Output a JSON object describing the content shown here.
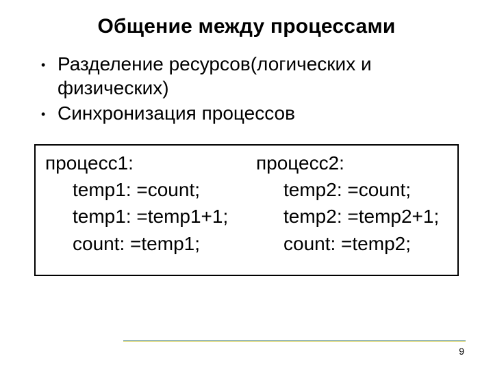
{
  "title": "Общение между процессами",
  "bullets": [
    "Разделение ресурсов(логических и физических)",
    "Синхронизация процессов"
  ],
  "code": {
    "left": {
      "header": "процесс1:",
      "lines": [
        "temp1: =count;",
        "temp1: =temp1+1;",
        "count: =temp1;"
      ]
    },
    "right": {
      "header": "процесс2:",
      "lines": [
        "temp2: =count;",
        "temp2: =temp2+1;",
        "count: =temp2;"
      ]
    }
  },
  "page_number": "9"
}
